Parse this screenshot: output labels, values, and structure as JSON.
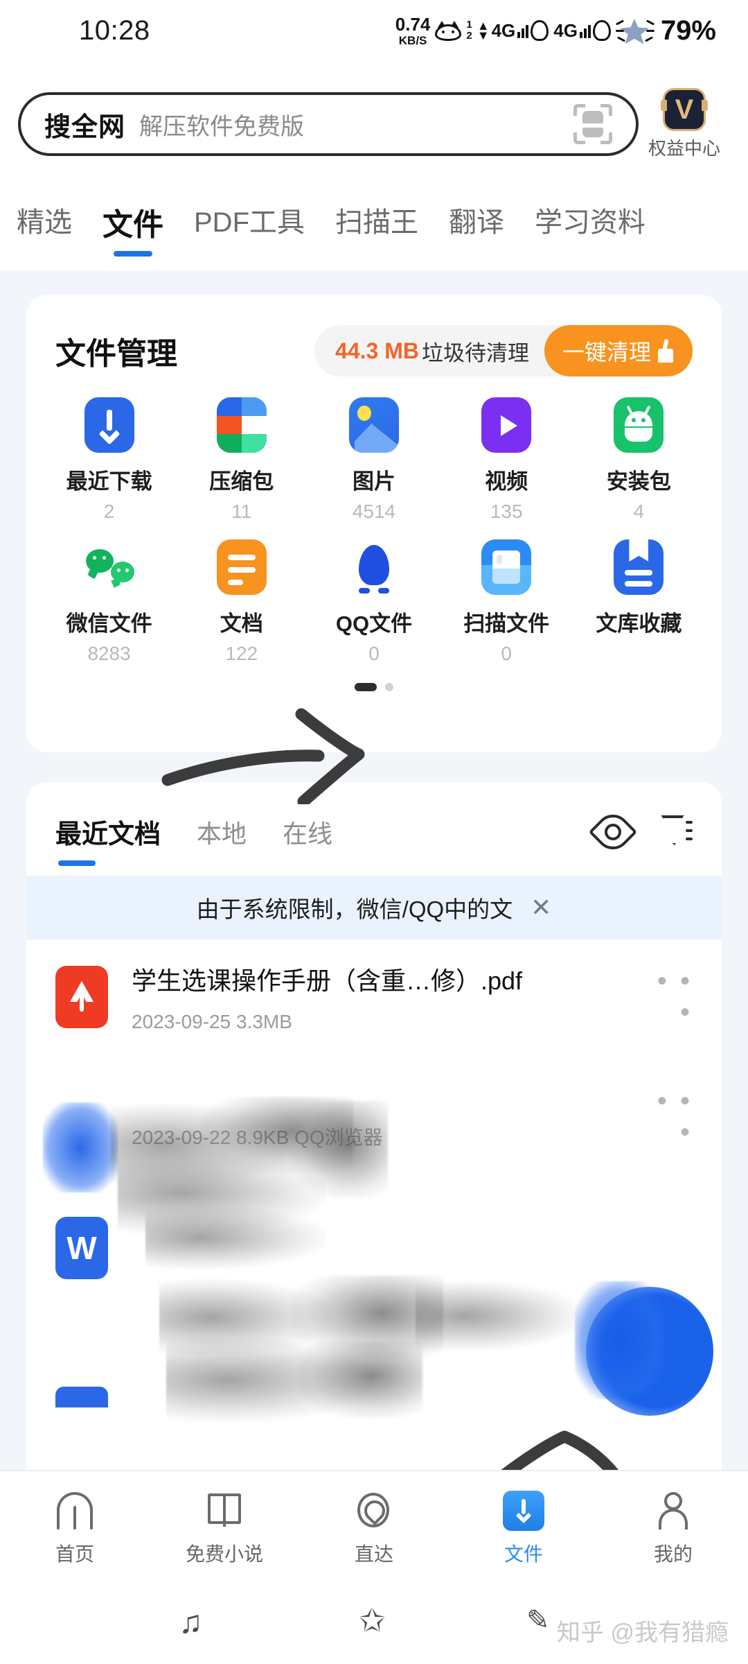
{
  "status_bar": {
    "time": "10:28",
    "net_speed_value": "0.74",
    "net_speed_unit": "KB/S",
    "sim1_label": "1",
    "sim2_label": "2",
    "network_1": "4G",
    "network_2": "4G",
    "battery_percent": "79%"
  },
  "search": {
    "keyword": "搜全网",
    "suggestion": "解压软件免费版",
    "scan_icon": "scan-document-icon",
    "vip_letter": "V",
    "vip_label": "权益中心"
  },
  "top_tabs": [
    {
      "label": "精选",
      "active": false
    },
    {
      "label": "文件",
      "active": true
    },
    {
      "label": "PDF工具",
      "active": false
    },
    {
      "label": "扫描王",
      "active": false
    },
    {
      "label": "翻译",
      "active": false
    },
    {
      "label": "学习资料",
      "active": false
    }
  ],
  "file_manager": {
    "title": "文件管理",
    "junk_size": "44.3 MB",
    "junk_text": "垃圾待清理",
    "clean_button": "一键清理",
    "items": [
      {
        "name": "最近下载",
        "count": "2",
        "icon": "download-icon"
      },
      {
        "name": "压缩包",
        "count": "11",
        "icon": "zip-archive-icon"
      },
      {
        "name": "图片",
        "count": "4514",
        "icon": "picture-icon"
      },
      {
        "name": "视频",
        "count": "135",
        "icon": "video-play-icon"
      },
      {
        "name": "安装包",
        "count": "4",
        "icon": "android-apk-icon"
      },
      {
        "name": "微信文件",
        "count": "8283",
        "icon": "wechat-icon"
      },
      {
        "name": "文档",
        "count": "122",
        "icon": "document-icon"
      },
      {
        "name": "QQ文件",
        "count": "0",
        "icon": "qq-penguin-icon"
      },
      {
        "name": "扫描文件",
        "count": "0",
        "icon": "scan-file-icon"
      },
      {
        "name": "文库收藏",
        "count": "",
        "icon": "bookmark-doc-icon"
      }
    ],
    "page_dots": 2,
    "active_dot": 0
  },
  "recent_docs": {
    "tabs": [
      {
        "label": "最近文档",
        "active": true
      },
      {
        "label": "本地",
        "active": false
      },
      {
        "label": "在线",
        "active": false
      }
    ],
    "eye_icon": "eye-icon",
    "filter_icon": "filter-icon",
    "notice_text": "由于系统限制，微信/QQ中的文",
    "notice_close": "✕",
    "items": [
      {
        "icon": "pdf-file-icon",
        "name": "学生选课操作手册（含重…修）.pdf",
        "meta": "2023-09-25  3.3MB",
        "more": "• • •",
        "redacted": false
      },
      {
        "icon": "file-icon-redacted",
        "name": "",
        "meta": "2023-09-22  8.9KB  QQ浏览器",
        "more": "• • •",
        "redacted": true
      },
      {
        "icon": "word-file-icon",
        "name": "",
        "meta": "",
        "more": "",
        "redacted": true
      },
      {
        "icon": "file-icon-partial",
        "name": "",
        "meta": "",
        "more": "",
        "redacted": true
      }
    ]
  },
  "bottom_nav": [
    {
      "label": "首页",
      "icon": "home-icon",
      "active": false
    },
    {
      "label": "免费小说",
      "icon": "book-icon",
      "active": false
    },
    {
      "label": "直达",
      "icon": "compass-icon",
      "active": false
    },
    {
      "label": "文件",
      "icon": "file-download-icon",
      "active": true
    },
    {
      "label": "我的",
      "icon": "person-icon",
      "active": false
    }
  ],
  "system_row": {
    "music_icon": "♫",
    "star_icon": "✩",
    "watermark": "知乎 @我有猎瘾"
  },
  "colors": {
    "accent_blue": "#2b68e8",
    "tab_underline": "#1a73e8",
    "orange": "#f7931e",
    "junk_red": "#f4632a",
    "nav_active": "#2b8cf5",
    "page_bg": "#f2f5fa",
    "notice_bg": "#eaf3fd",
    "annotation": "#3c3c3c"
  }
}
